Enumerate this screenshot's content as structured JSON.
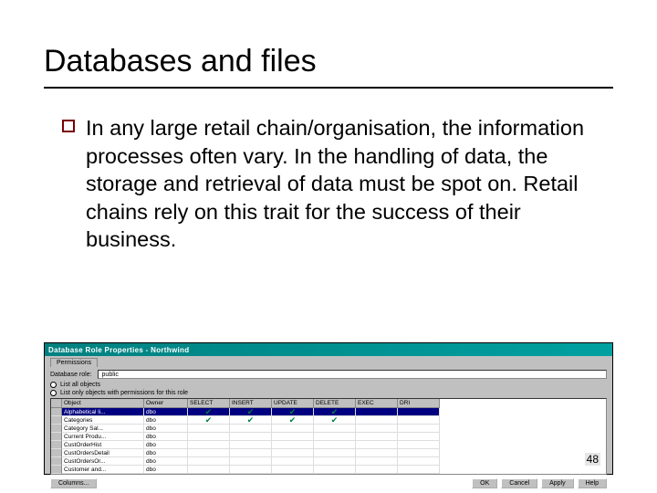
{
  "slide": {
    "title": "Databases and files",
    "bullet_text": "In any large retail chain/organisation, the information processes often vary. In the handling of data, the storage and retrieval of data must be spot on. Retail chains rely on this trait for the success of their business.",
    "page_number": "48"
  },
  "dialog": {
    "title": "Database Role Properties - Northwind",
    "tab": "Permissions",
    "role_label": "Database role:",
    "role_value": "public",
    "radio1": "List all objects",
    "radio2": "List only objects with permissions for this role",
    "headers": [
      "",
      "Object",
      "Owner",
      "SELECT",
      "INSERT",
      "UPDATE",
      "DELETE",
      "EXEC",
      "DRI"
    ],
    "rows": [
      {
        "obj": "Alphabetical li...",
        "owner": "dbo",
        "sel": true,
        "ins": true,
        "upd": true,
        "del": true,
        "selected": true
      },
      {
        "obj": "Categories",
        "owner": "dbo",
        "sel": true,
        "ins": true,
        "upd": true,
        "del": true
      },
      {
        "obj": "Category Sal...",
        "owner": "dbo"
      },
      {
        "obj": "Current Produ...",
        "owner": "dbo"
      },
      {
        "obj": "CustOrderHist",
        "owner": "dbo"
      },
      {
        "obj": "CustOrdersDetail",
        "owner": "dbo"
      },
      {
        "obj": "CustOrdersOr...",
        "owner": "dbo"
      },
      {
        "obj": "Customer and...",
        "owner": "dbo"
      }
    ],
    "columns_btn": "Columns...",
    "buttons": [
      "OK",
      "Cancel",
      "Apply",
      "Help"
    ]
  }
}
